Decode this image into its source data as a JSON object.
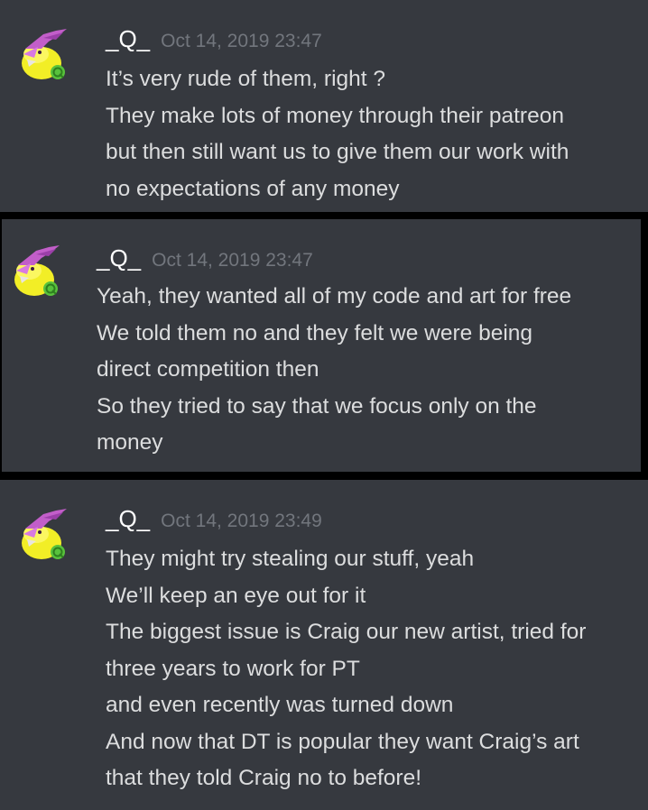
{
  "messages": [
    {
      "author": "_Q_",
      "timestamp": "Oct 14, 2019 23:47",
      "lines": [
        "It’s very rude of them, right ?",
        "They make lots of money through their patreon",
        "but then still want us to give them our work with",
        "no expectations of any money"
      ]
    },
    {
      "author": "_Q_",
      "timestamp": "Oct 14, 2019 23:47",
      "lines": [
        "Yeah, they wanted all of my code and art for free",
        "We told them no and they felt we were being",
        "direct competition then",
        "So they tried to say that we focus only on the",
        "money"
      ]
    },
    {
      "author": "_Q_",
      "timestamp": "Oct 14, 2019 23:49",
      "lines": [
        "They might try stealing our stuff, yeah",
        "We’ll keep an eye out for it",
        "The biggest issue is Craig our new artist, tried for",
        "three years to work for PT",
        "and even recently was turned down",
        "And now that DT is popular they want Craig’s art",
        "that they told Craig no to before!"
      ]
    }
  ],
  "colors": {
    "background": "#36393f",
    "separator": "#000000",
    "username": "#ffffff",
    "timestamp": "#72767d",
    "text": "#dcddde",
    "avatar_yellow": "#f2ee26",
    "avatar_pink": "#c25ec9",
    "avatar_green": "#58c23c"
  },
  "icons": {
    "avatar": "dragon-avatar-icon"
  }
}
